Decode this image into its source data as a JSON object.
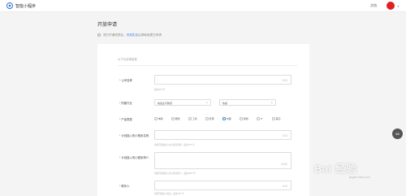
{
  "header": {
    "app_name": "智能小程序",
    "doc_link": "文档",
    "avatar_color": "#e02020"
  },
  "page": {
    "title": "开放申请",
    "notice_prefix": "请已开通资质后，",
    "notice_link": "完成实名",
    "notice_suffix": "后再继续提交申请"
  },
  "form": {
    "section_title": "以下为必填信息",
    "company_name": {
      "label": "公司名称",
      "counter": "0/30",
      "hint": "最多30个字"
    },
    "industry": {
      "label": "所属行业",
      "primary": "快递业与物流",
      "secondary": "快递"
    },
    "product_type": {
      "label": "产品类型",
      "options": [
        "电商",
        "服务",
        "工具",
        "影音",
        "内容",
        "游戏",
        "IT",
        "其它"
      ],
      "selected_index": 4
    },
    "plan_name": {
      "label": "计划接入的小程序名称",
      "counter": "0/15",
      "hint": "请填写准备接入的小程序名称，最多15个字"
    },
    "plan_desc": {
      "label": "计划接入的小程序简介",
      "counter": "0/200",
      "hint": "请填写准备接入的小程序简介，最多200个字"
    },
    "contact": {
      "label": "联系人",
      "counter": "0/15",
      "hint": "请填写联系人姓名，最多15个字"
    }
  },
  "scroll_badge": "88",
  "watermark": {
    "main": "Bai 经验",
    "sub": "jingyan.baidu.com"
  }
}
